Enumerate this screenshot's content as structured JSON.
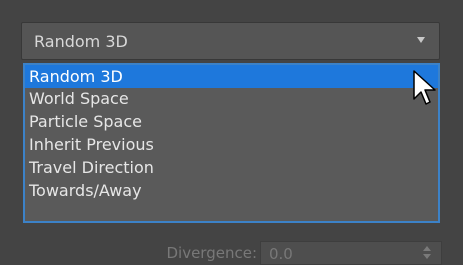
{
  "combo": {
    "value": "Random 3D",
    "arrow_icon": "chevron-down-icon"
  },
  "dropdown": {
    "items": [
      {
        "label": "Random 3D",
        "selected": true
      },
      {
        "label": "World Space",
        "selected": false
      },
      {
        "label": "Particle Space",
        "selected": false
      },
      {
        "label": "Inherit Previous",
        "selected": false
      },
      {
        "label": "Travel Direction",
        "selected": false
      },
      {
        "label": "Towards/Away",
        "selected": false
      }
    ]
  },
  "divergence": {
    "label": "Divergence:",
    "value": "0.0",
    "arrow_icon": "spinner-icon"
  },
  "colors": {
    "background": "#444444",
    "selection": "#1e78dc",
    "dropdown_border": "#3c82c8",
    "text": "#e6e6e6",
    "disabled_text": "#787878"
  }
}
